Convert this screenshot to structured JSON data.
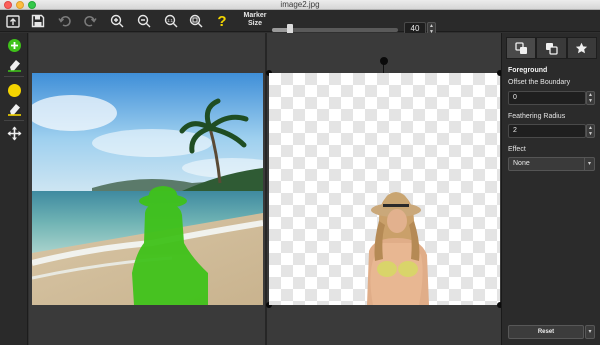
{
  "window": {
    "title": "image2.jpg"
  },
  "toolbar": {
    "buttons": [
      "open-icon",
      "save-icon",
      "undo-icon",
      "redo-icon",
      "zoom-in-icon",
      "zoom-out-icon",
      "zoom-actual-icon",
      "zoom-fit-icon",
      "help-icon"
    ],
    "help_glyph": "?",
    "marker_label": "Marker Size",
    "marker_value": "40",
    "marker_level_fraction": 0.14
  },
  "left_tools": [
    "add-foreground-icon",
    "eraser-icon",
    "background-marker-icon",
    "background-eraser-icon",
    "move-icon"
  ],
  "colors": {
    "foreground_marker": "#3fc21a",
    "background_marker": "#f4d400",
    "panel": "#2b2b2b"
  },
  "right_panel": {
    "tabs": [
      "foreground-tab-icon",
      "background-tab-icon",
      "favorites-tab-icon"
    ],
    "section_title": "Foreground",
    "offset_label": "Offset the Boundary",
    "offset_value": "0",
    "feather_label": "Feathering Radius",
    "feather_value": "2",
    "effect_label": "Effect",
    "effect_value": "None",
    "reset_label": "Reset"
  }
}
